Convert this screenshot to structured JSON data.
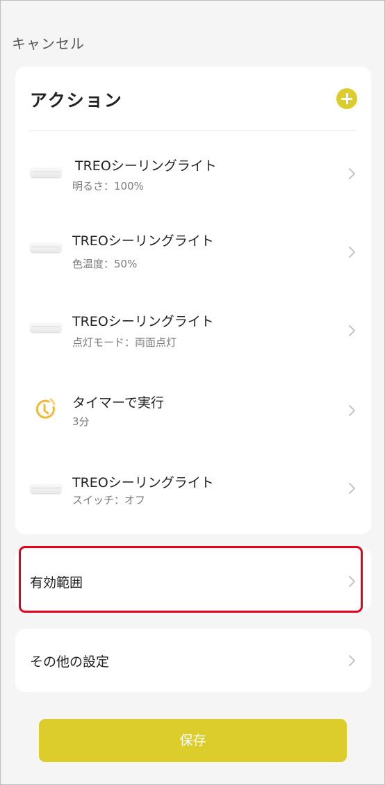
{
  "header": {
    "cancel_label": "キャンセル"
  },
  "actions": {
    "title": "アクション",
    "add_icon": "plus-icon",
    "items": [
      {
        "icon": "ceiling-light-icon",
        "title": "TREOシーリングライト",
        "subtitle": "明るさ：100%"
      },
      {
        "icon": "ceiling-light-icon",
        "title": "TREOシーリングライト",
        "subtitle": "色温度：50%"
      },
      {
        "icon": "ceiling-light-icon",
        "title": "TREOシーリングライト",
        "subtitle": "点灯モード：両面点灯"
      },
      {
        "icon": "timer-icon",
        "title": "タイマーで実行",
        "subtitle": "3分"
      },
      {
        "icon": "ceiling-light-icon",
        "title": "TREOシーリングライト",
        "subtitle": "スイッチ：オフ"
      }
    ]
  },
  "scope": {
    "label": "有効範囲"
  },
  "other_settings": {
    "label": "その他の設定"
  },
  "footer": {
    "save_label": "保存"
  },
  "colors": {
    "accent": "#ddcd2c",
    "highlight": "#e6001a",
    "timer": "#f0b93a",
    "background": "#f5f5f5",
    "card": "#ffffff"
  }
}
